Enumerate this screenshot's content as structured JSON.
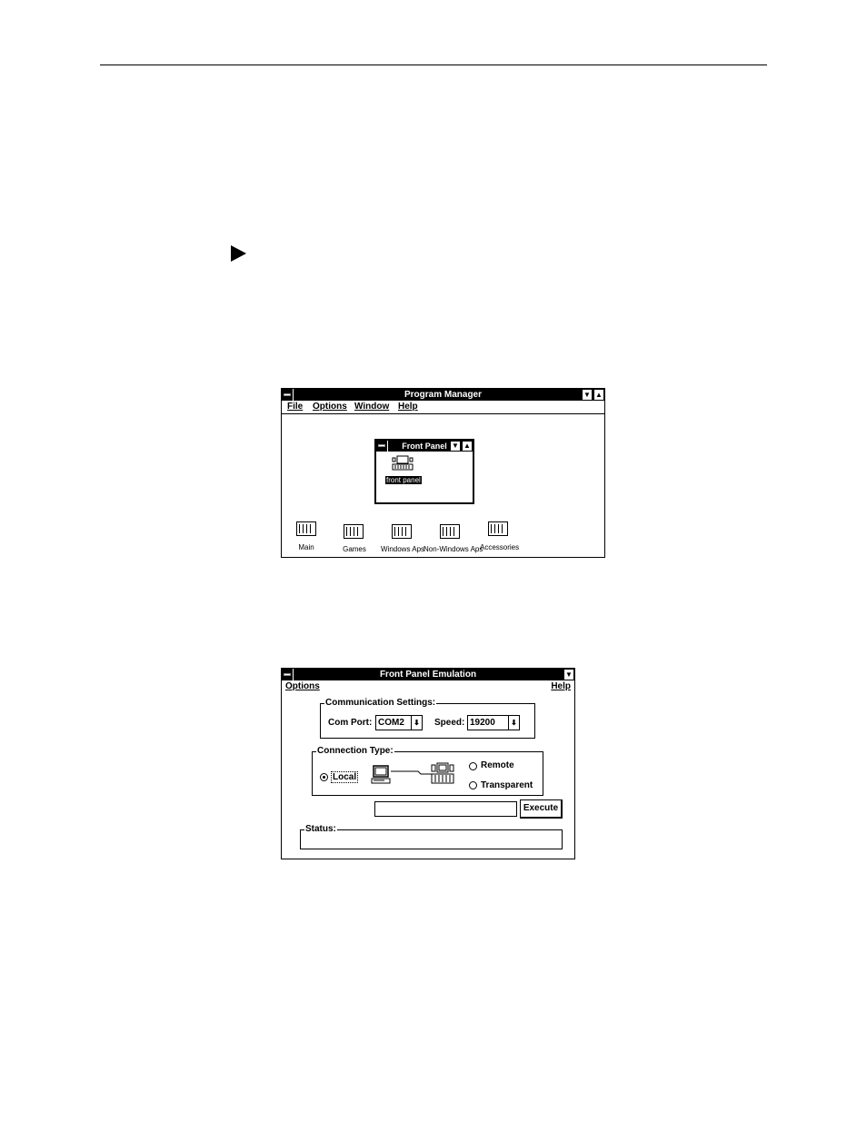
{
  "program_manager": {
    "title": "Program Manager",
    "menu": [
      "File",
      "Options",
      "Window",
      "Help"
    ],
    "front_panel_window": {
      "title": "Front Panel",
      "icon_label": "front panel"
    },
    "groups": [
      "Main",
      "Games",
      "Windows Aps",
      "Non-Windows Aps",
      "Accessories"
    ]
  },
  "front_panel_emulation": {
    "title": "Front Panel Emulation",
    "menu_left": "Options",
    "menu_right": "Help",
    "comm_settings": {
      "legend": "Communication Settings:",
      "com_port_label": "Com Port:",
      "com_port_value": "COM2",
      "speed_label": "Speed:",
      "speed_value": "19200"
    },
    "connection_type": {
      "legend": "Connection Type:",
      "local": "Local",
      "remote": "Remote",
      "transparent": "Transparent",
      "selected": "Local"
    },
    "command_input": "",
    "execute_label": "Execute",
    "status_legend": "Status:"
  },
  "icons": [
    "arrow-right-icon",
    "system-menu-icon",
    "minimize-icon",
    "maximize-icon",
    "program-group-icon",
    "computer-icon",
    "front-panel-device-icon"
  ]
}
